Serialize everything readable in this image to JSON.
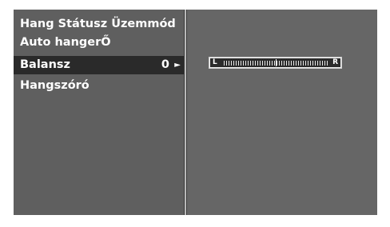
{
  "menu": {
    "items": [
      {
        "label": "Hang Státusz Üzemmód"
      },
      {
        "label": "Auto hangerŐ"
      },
      {
        "label": "Balansz",
        "value": "0",
        "arrow": "►"
      },
      {
        "label": "Hangszóró"
      }
    ],
    "selected_index": 2
  },
  "balance": {
    "left_label": "L",
    "right_label": "R",
    "value": 0
  }
}
